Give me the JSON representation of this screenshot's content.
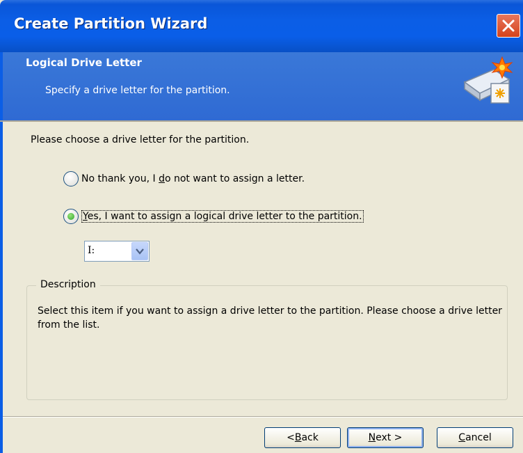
{
  "window": {
    "title": "Create Partition Wizard",
    "close_icon": "close-icon"
  },
  "header": {
    "title": "Logical Drive Letter",
    "subtitle": "Specify a drive letter for the partition.",
    "icon": "disk-wizard-icon"
  },
  "content": {
    "prompt": "Please choose a drive letter for the partition.",
    "options": [
      {
        "pre": "No thank you, I ",
        "accel": "d",
        "post": "o not want to assign a letter.",
        "selected": false
      },
      {
        "pre": "",
        "accel": "Y",
        "post": "es, I want to assign a logical drive letter to the partition.",
        "selected": true
      }
    ],
    "drive_letter": {
      "value": "I:"
    }
  },
  "description": {
    "title": "Description",
    "text": "Select this item if you want to assign a drive letter to the partition. Please choose a drive letter from the list."
  },
  "buttons": {
    "back": {
      "pre": "< ",
      "accel": "B",
      "post": "ack"
    },
    "next": {
      "pre": "",
      "accel": "N",
      "post": "ext >"
    },
    "cancel": {
      "pre": "",
      "accel": "C",
      "post": "ancel"
    }
  },
  "colors": {
    "titlebar": "#0b5ee6",
    "header": "#3270d6",
    "dialog_bg": "#ece9d8",
    "radio_selected": "#2da52a"
  }
}
